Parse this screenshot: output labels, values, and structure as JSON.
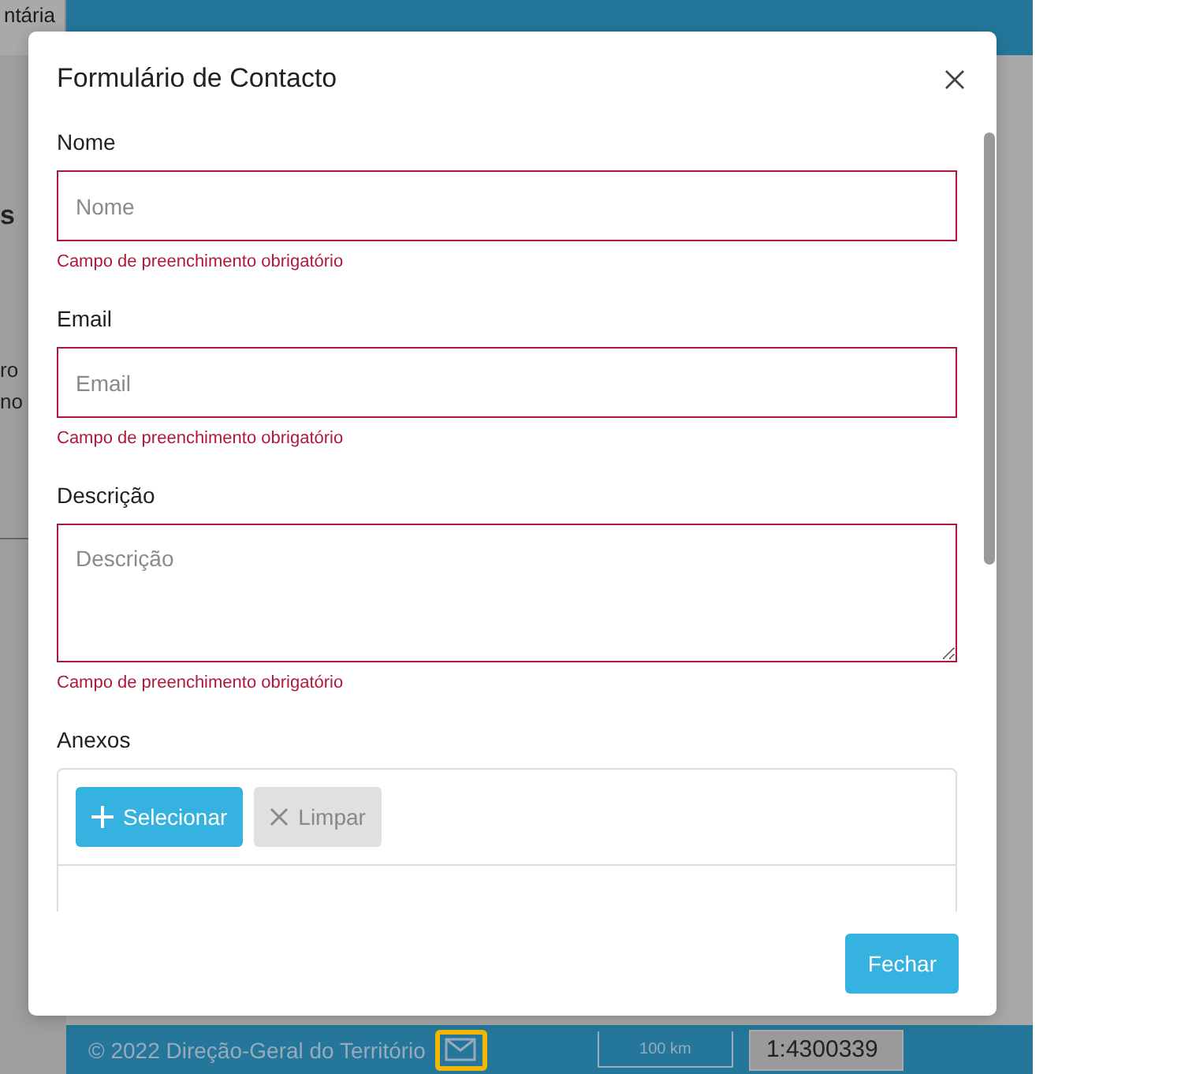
{
  "background": {
    "tab_label": "ntária",
    "heading": "s",
    "panel_lines": [
      "ro",
      "no"
    ],
    "footer": {
      "copyright": "© 2022 Direção-Geral do Território",
      "scale_bar": "100 km",
      "scale": "1:4300339"
    }
  },
  "dialog": {
    "title": "Formulário de Contacto",
    "fields": [
      {
        "kind": "input",
        "label": "Nome",
        "placeholder": "Nome",
        "error": "Campo de preenchimento obrigatório"
      },
      {
        "kind": "input",
        "label": "Email",
        "placeholder": "Email",
        "error": "Campo de preenchimento obrigatório"
      },
      {
        "kind": "textarea",
        "label": "Descrição",
        "placeholder": "Descrição",
        "error": "Campo de preenchimento obrigatório"
      }
    ],
    "attachments": {
      "label": "Anexos",
      "buttons": [
        {
          "kind": "add",
          "label": "Selecionar",
          "disabled": false
        },
        {
          "kind": "clear",
          "label": "Limpar",
          "disabled": true
        }
      ]
    },
    "buttons": [
      "Fechar"
    ]
  }
}
